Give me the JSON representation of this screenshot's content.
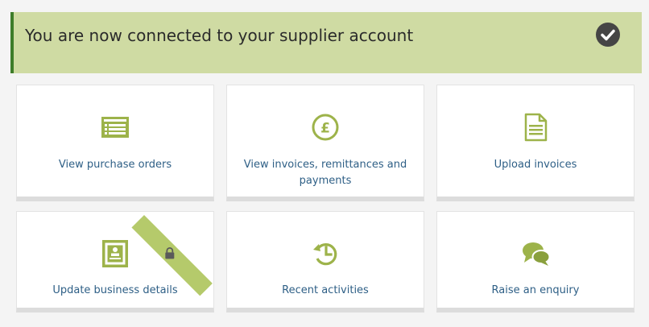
{
  "banner": {
    "message": "You are now connected to your supplier account",
    "icon": "check-circle-icon",
    "color": "#cfdba3",
    "accent": "#3e7d2a"
  },
  "tiles": [
    {
      "label": "View purchase orders",
      "icon": "purchase-orders-icon"
    },
    {
      "label": "View invoices, remittances and payments",
      "icon": "pound-coin-icon"
    },
    {
      "label": "Upload invoices",
      "icon": "document-icon"
    },
    {
      "label": "Update business details",
      "icon": "business-card-icon",
      "locked": true
    },
    {
      "label": "Recent activities",
      "icon": "history-icon"
    },
    {
      "label": "Raise an enquiry",
      "icon": "chat-bubbles-icon"
    }
  ],
  "colors": {
    "icon_green": "#9db34a",
    "link_blue": "#2e5f86",
    "ribbon_green": "#b5ca6b"
  }
}
